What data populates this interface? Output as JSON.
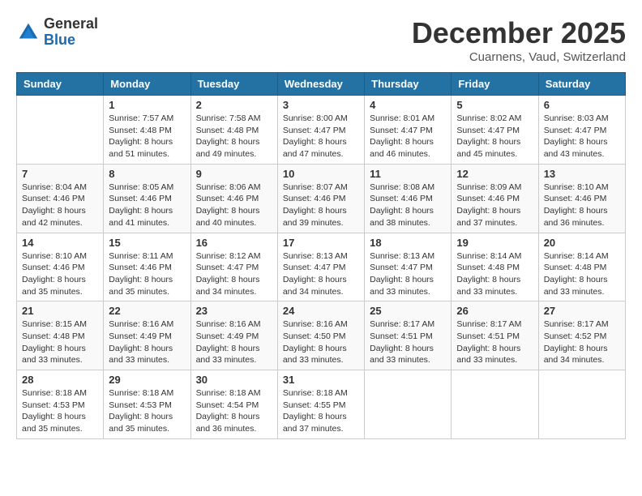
{
  "header": {
    "logo_general": "General",
    "logo_blue": "Blue",
    "month_title": "December 2025",
    "location": "Cuarnens, Vaud, Switzerland"
  },
  "weekdays": [
    "Sunday",
    "Monday",
    "Tuesday",
    "Wednesday",
    "Thursday",
    "Friday",
    "Saturday"
  ],
  "weeks": [
    [
      {
        "day": "",
        "sunrise": "",
        "sunset": "",
        "daylight": ""
      },
      {
        "day": "1",
        "sunrise": "Sunrise: 7:57 AM",
        "sunset": "Sunset: 4:48 PM",
        "daylight": "Daylight: 8 hours and 51 minutes."
      },
      {
        "day": "2",
        "sunrise": "Sunrise: 7:58 AM",
        "sunset": "Sunset: 4:48 PM",
        "daylight": "Daylight: 8 hours and 49 minutes."
      },
      {
        "day": "3",
        "sunrise": "Sunrise: 8:00 AM",
        "sunset": "Sunset: 4:47 PM",
        "daylight": "Daylight: 8 hours and 47 minutes."
      },
      {
        "day": "4",
        "sunrise": "Sunrise: 8:01 AM",
        "sunset": "Sunset: 4:47 PM",
        "daylight": "Daylight: 8 hours and 46 minutes."
      },
      {
        "day": "5",
        "sunrise": "Sunrise: 8:02 AM",
        "sunset": "Sunset: 4:47 PM",
        "daylight": "Daylight: 8 hours and 45 minutes."
      },
      {
        "day": "6",
        "sunrise": "Sunrise: 8:03 AM",
        "sunset": "Sunset: 4:47 PM",
        "daylight": "Daylight: 8 hours and 43 minutes."
      }
    ],
    [
      {
        "day": "7",
        "sunrise": "Sunrise: 8:04 AM",
        "sunset": "Sunset: 4:46 PM",
        "daylight": "Daylight: 8 hours and 42 minutes."
      },
      {
        "day": "8",
        "sunrise": "Sunrise: 8:05 AM",
        "sunset": "Sunset: 4:46 PM",
        "daylight": "Daylight: 8 hours and 41 minutes."
      },
      {
        "day": "9",
        "sunrise": "Sunrise: 8:06 AM",
        "sunset": "Sunset: 4:46 PM",
        "daylight": "Daylight: 8 hours and 40 minutes."
      },
      {
        "day": "10",
        "sunrise": "Sunrise: 8:07 AM",
        "sunset": "Sunset: 4:46 PM",
        "daylight": "Daylight: 8 hours and 39 minutes."
      },
      {
        "day": "11",
        "sunrise": "Sunrise: 8:08 AM",
        "sunset": "Sunset: 4:46 PM",
        "daylight": "Daylight: 8 hours and 38 minutes."
      },
      {
        "day": "12",
        "sunrise": "Sunrise: 8:09 AM",
        "sunset": "Sunset: 4:46 PM",
        "daylight": "Daylight: 8 hours and 37 minutes."
      },
      {
        "day": "13",
        "sunrise": "Sunrise: 8:10 AM",
        "sunset": "Sunset: 4:46 PM",
        "daylight": "Daylight: 8 hours and 36 minutes."
      }
    ],
    [
      {
        "day": "14",
        "sunrise": "Sunrise: 8:10 AM",
        "sunset": "Sunset: 4:46 PM",
        "daylight": "Daylight: 8 hours and 35 minutes."
      },
      {
        "day": "15",
        "sunrise": "Sunrise: 8:11 AM",
        "sunset": "Sunset: 4:46 PM",
        "daylight": "Daylight: 8 hours and 35 minutes."
      },
      {
        "day": "16",
        "sunrise": "Sunrise: 8:12 AM",
        "sunset": "Sunset: 4:47 PM",
        "daylight": "Daylight: 8 hours and 34 minutes."
      },
      {
        "day": "17",
        "sunrise": "Sunrise: 8:13 AM",
        "sunset": "Sunset: 4:47 PM",
        "daylight": "Daylight: 8 hours and 34 minutes."
      },
      {
        "day": "18",
        "sunrise": "Sunrise: 8:13 AM",
        "sunset": "Sunset: 4:47 PM",
        "daylight": "Daylight: 8 hours and 33 minutes."
      },
      {
        "day": "19",
        "sunrise": "Sunrise: 8:14 AM",
        "sunset": "Sunset: 4:48 PM",
        "daylight": "Daylight: 8 hours and 33 minutes."
      },
      {
        "day": "20",
        "sunrise": "Sunrise: 8:14 AM",
        "sunset": "Sunset: 4:48 PM",
        "daylight": "Daylight: 8 hours and 33 minutes."
      }
    ],
    [
      {
        "day": "21",
        "sunrise": "Sunrise: 8:15 AM",
        "sunset": "Sunset: 4:48 PM",
        "daylight": "Daylight: 8 hours and 33 minutes."
      },
      {
        "day": "22",
        "sunrise": "Sunrise: 8:16 AM",
        "sunset": "Sunset: 4:49 PM",
        "daylight": "Daylight: 8 hours and 33 minutes."
      },
      {
        "day": "23",
        "sunrise": "Sunrise: 8:16 AM",
        "sunset": "Sunset: 4:49 PM",
        "daylight": "Daylight: 8 hours and 33 minutes."
      },
      {
        "day": "24",
        "sunrise": "Sunrise: 8:16 AM",
        "sunset": "Sunset: 4:50 PM",
        "daylight": "Daylight: 8 hours and 33 minutes."
      },
      {
        "day": "25",
        "sunrise": "Sunrise: 8:17 AM",
        "sunset": "Sunset: 4:51 PM",
        "daylight": "Daylight: 8 hours and 33 minutes."
      },
      {
        "day": "26",
        "sunrise": "Sunrise: 8:17 AM",
        "sunset": "Sunset: 4:51 PM",
        "daylight": "Daylight: 8 hours and 33 minutes."
      },
      {
        "day": "27",
        "sunrise": "Sunrise: 8:17 AM",
        "sunset": "Sunset: 4:52 PM",
        "daylight": "Daylight: 8 hours and 34 minutes."
      }
    ],
    [
      {
        "day": "28",
        "sunrise": "Sunrise: 8:18 AM",
        "sunset": "Sunset: 4:53 PM",
        "daylight": "Daylight: 8 hours and 35 minutes."
      },
      {
        "day": "29",
        "sunrise": "Sunrise: 8:18 AM",
        "sunset": "Sunset: 4:53 PM",
        "daylight": "Daylight: 8 hours and 35 minutes."
      },
      {
        "day": "30",
        "sunrise": "Sunrise: 8:18 AM",
        "sunset": "Sunset: 4:54 PM",
        "daylight": "Daylight: 8 hours and 36 minutes."
      },
      {
        "day": "31",
        "sunrise": "Sunrise: 8:18 AM",
        "sunset": "Sunset: 4:55 PM",
        "daylight": "Daylight: 8 hours and 37 minutes."
      },
      {
        "day": "",
        "sunrise": "",
        "sunset": "",
        "daylight": ""
      },
      {
        "day": "",
        "sunrise": "",
        "sunset": "",
        "daylight": ""
      },
      {
        "day": "",
        "sunrise": "",
        "sunset": "",
        "daylight": ""
      }
    ]
  ]
}
